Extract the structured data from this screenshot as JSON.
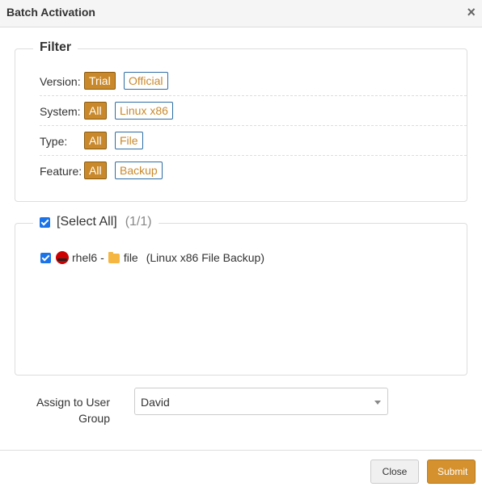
{
  "dialog": {
    "title": "Batch Activation",
    "close_symbol": "×"
  },
  "filter": {
    "legend": "Filter",
    "rows": [
      {
        "label": "Version:",
        "options": [
          {
            "text": "Trial",
            "active": true
          },
          {
            "text": "Official",
            "active": false
          }
        ]
      },
      {
        "label": "System:",
        "options": [
          {
            "text": "All",
            "active": true
          },
          {
            "text": "Linux x86",
            "active": false
          }
        ]
      },
      {
        "label": "Type:",
        "options": [
          {
            "text": "All",
            "active": true
          },
          {
            "text": "File",
            "active": false
          }
        ]
      },
      {
        "label": "Feature:",
        "options": [
          {
            "text": "All",
            "active": true
          },
          {
            "text": "Backup",
            "active": false
          }
        ]
      }
    ]
  },
  "selection": {
    "select_all_label": "[Select All]",
    "count": "(1/1)",
    "select_all_checked": true,
    "items": [
      {
        "checked": true,
        "os_icon": "redhat-icon",
        "host": "rhel6",
        "separator": "-",
        "type_icon": "folder-icon",
        "name": "file",
        "description": "(Linux x86 File Backup)"
      }
    ]
  },
  "assign": {
    "label": "Assign to User Group",
    "selected": "David"
  },
  "footer": {
    "close_label": "Close",
    "submit_label": "Submit"
  },
  "colors": {
    "accent": "#c9892b",
    "submit": "#d4912e",
    "checkbox": "#1a73e8"
  }
}
